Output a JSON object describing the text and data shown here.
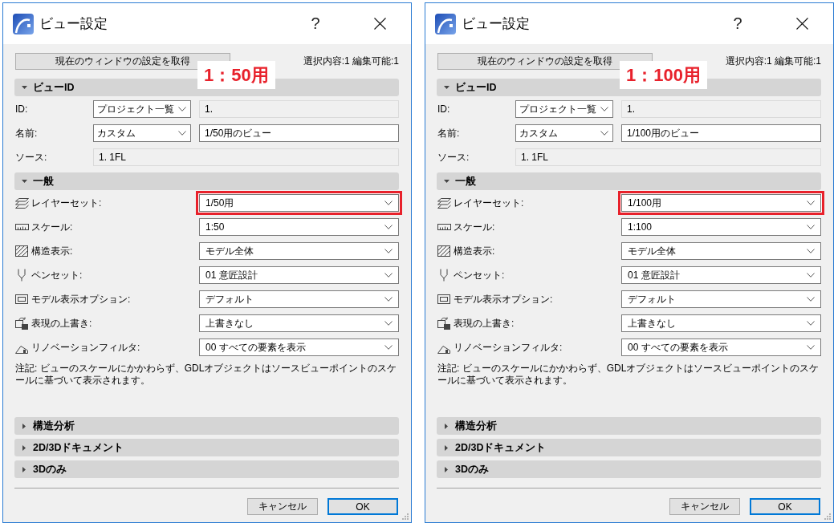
{
  "dialogs": [
    {
      "title": "ビュー設定",
      "help_button": "?",
      "get_settings_button": "現在のウィンドウの設定を取得",
      "selection_info": "選択内容:1 編集可能:1",
      "annotation": "1：50用",
      "sections": [
        {
          "title": "ビューID",
          "expanded": true,
          "rows": [
            {
              "kind": "pair",
              "label": "ID:",
              "dropdown": "プロジェクト一覧",
              "field": {
                "value": "1.",
                "disabled": true
              }
            },
            {
              "kind": "pair",
              "label": "名前:",
              "dropdown": "カスタム",
              "field": {
                "value": "1/50用のビュー",
                "disabled": false
              }
            },
            {
              "kind": "field",
              "label": "ソース:",
              "field": {
                "value": "1. 1FL",
                "disabled": true
              }
            }
          ]
        },
        {
          "title": "一般",
          "expanded": true,
          "rows": [
            {
              "kind": "select",
              "label": "レイヤーセット:",
              "value": "1/50用",
              "highlighted": true
            },
            {
              "kind": "select",
              "label": "スケール:",
              "value": "1:50",
              "highlighted": false
            },
            {
              "kind": "select",
              "label": "構造表示:",
              "value": "モデル全体",
              "highlighted": false
            },
            {
              "kind": "select",
              "label": "ペンセット:",
              "value": "01 意匠設計",
              "highlighted": false
            },
            {
              "kind": "select",
              "label": "モデル表示オプション:",
              "value": "デフォルト",
              "highlighted": false
            },
            {
              "kind": "select",
              "label": "表現の上書き:",
              "value": "上書きなし",
              "highlighted": false
            },
            {
              "kind": "select",
              "label": "リノベーションフィルタ:",
              "value": "00 すべての要素を表示",
              "highlighted": false
            }
          ],
          "note": "注記: ビューのスケールにかかわらず、GDLオブジェクトはソースビューポイントのスケールに基づいて表示されます。"
        },
        {
          "title": "構造分析",
          "expanded": false
        },
        {
          "title": "2D/3Dドキュメント",
          "expanded": false
        },
        {
          "title": "3Dのみ",
          "expanded": false
        }
      ],
      "buttons": [
        {
          "label": "キャンセル",
          "default": false
        },
        {
          "label": "OK",
          "default": true
        }
      ]
    },
    {
      "title": "ビュー設定",
      "help_button": "?",
      "get_settings_button": "現在のウィンドウの設定を取得",
      "selection_info": "選択内容:1 編集可能:1",
      "annotation": "1：100用",
      "sections": [
        {
          "title": "ビューID",
          "expanded": true,
          "rows": [
            {
              "kind": "pair",
              "label": "ID:",
              "dropdown": "プロジェクト一覧",
              "field": {
                "value": "1.",
                "disabled": true
              }
            },
            {
              "kind": "pair",
              "label": "名前:",
              "dropdown": "カスタム",
              "field": {
                "value": "1/100用のビュー",
                "disabled": false
              }
            },
            {
              "kind": "field",
              "label": "ソース:",
              "field": {
                "value": "1. 1FL",
                "disabled": true
              }
            }
          ]
        },
        {
          "title": "一般",
          "expanded": true,
          "rows": [
            {
              "kind": "select",
              "label": "レイヤーセット:",
              "value": "1/100用",
              "highlighted": true
            },
            {
              "kind": "select",
              "label": "スケール:",
              "value": "1:100",
              "highlighted": false
            },
            {
              "kind": "select",
              "label": "構造表示:",
              "value": "モデル全体",
              "highlighted": false
            },
            {
              "kind": "select",
              "label": "ペンセット:",
              "value": "01 意匠設計",
              "highlighted": false
            },
            {
              "kind": "select",
              "label": "モデル表示オプション:",
              "value": "デフォルト",
              "highlighted": false
            },
            {
              "kind": "select",
              "label": "表現の上書き:",
              "value": "上書きなし",
              "highlighted": false
            },
            {
              "kind": "select",
              "label": "リノベーションフィルタ:",
              "value": "00 すべての要素を表示",
              "highlighted": false
            }
          ],
          "note": "注記: ビューのスケールにかかわらず、GDLオブジェクトはソースビューポイントのスケールに基づいて表示されます。"
        },
        {
          "title": "構造分析",
          "expanded": false
        },
        {
          "title": "2D/3Dドキュメント",
          "expanded": false
        },
        {
          "title": "3Dのみ",
          "expanded": false
        }
      ],
      "buttons": [
        {
          "label": "キャンセル",
          "default": false
        },
        {
          "label": "OK",
          "default": true
        }
      ]
    }
  ]
}
